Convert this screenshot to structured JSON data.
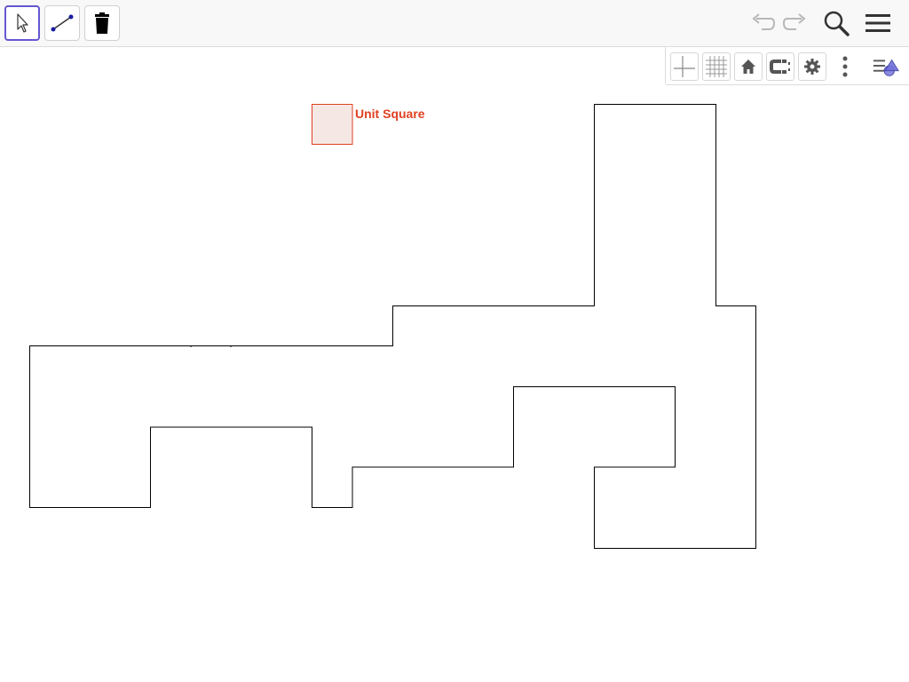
{
  "toolbar": {
    "tools": [
      {
        "icon": "move-arrow-icon",
        "selected": true
      },
      {
        "icon": "segment-icon",
        "selected": false
      },
      {
        "icon": "trash-icon",
        "selected": false
      }
    ],
    "right_icons": [
      "undo-icon",
      "redo-icon",
      "search-icon",
      "hamburger-menu-icon"
    ]
  },
  "graphics_bar": {
    "icons": [
      "axes-icon",
      "grid-icon",
      "home-icon",
      "point-capture-icon",
      "gear-icon",
      "more-vertical-icon",
      "style-bar-toggle-icon"
    ]
  },
  "canvas": {
    "unit_square": {
      "label": "Unit Square",
      "stroke_color": "#e04020",
      "fill_color": "#f5e8e4"
    },
    "polygon_stroke_color": "#000000"
  },
  "colors": {
    "accent": "#6557d2",
    "label": "#e04020",
    "toolbar_bg": "#f8f8f8"
  }
}
